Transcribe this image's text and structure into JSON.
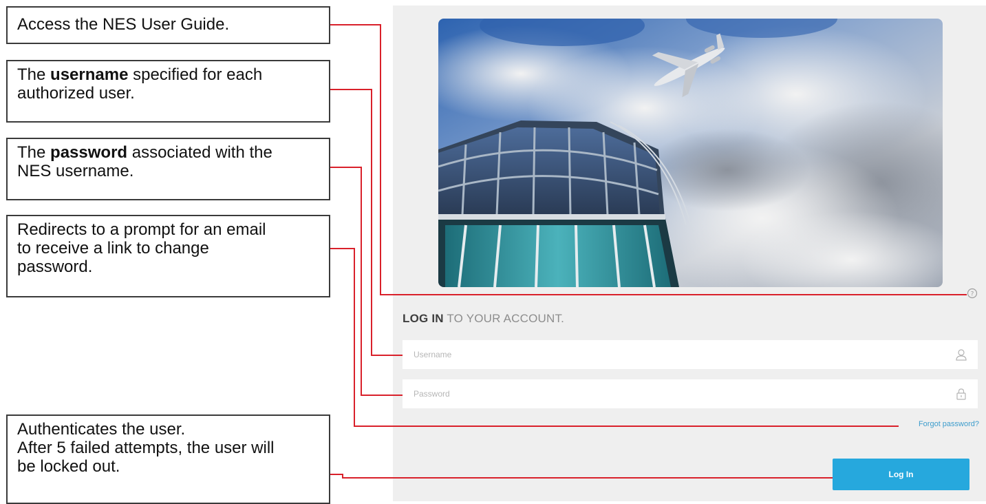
{
  "callouts": {
    "guide": {
      "text": "Access the NES User Guide."
    },
    "username": {
      "prefix": "The ",
      "bold": "username",
      "suffix": " specified for each",
      "line2": "authorized user."
    },
    "password": {
      "prefix": "The ",
      "bold": "password",
      "suffix": " associated with the",
      "line2": "NES username."
    },
    "forgot": {
      "line1": "Redirects to a prompt for an email",
      "line2": "to receive a link to change",
      "line3": "password."
    },
    "login": {
      "line1": "Authenticates the user.",
      "line2": "After 5 failed attempts, the user will",
      "line3": "be locked out."
    }
  },
  "login_panel": {
    "heading_strong": "LOG IN",
    "heading_rest": " TO YOUR ACCOUNT.",
    "username_placeholder": "Username",
    "password_placeholder": "Password",
    "forgot_password": "Forgot password?",
    "login_button": "Log In",
    "help_icon": "help-icon",
    "user_icon": "user-icon",
    "lock_icon": "lock-icon"
  },
  "colors": {
    "connector": "#d9202a",
    "button": "#26a8dd",
    "link": "#3c9ccc",
    "panel_background": "#efefef"
  }
}
